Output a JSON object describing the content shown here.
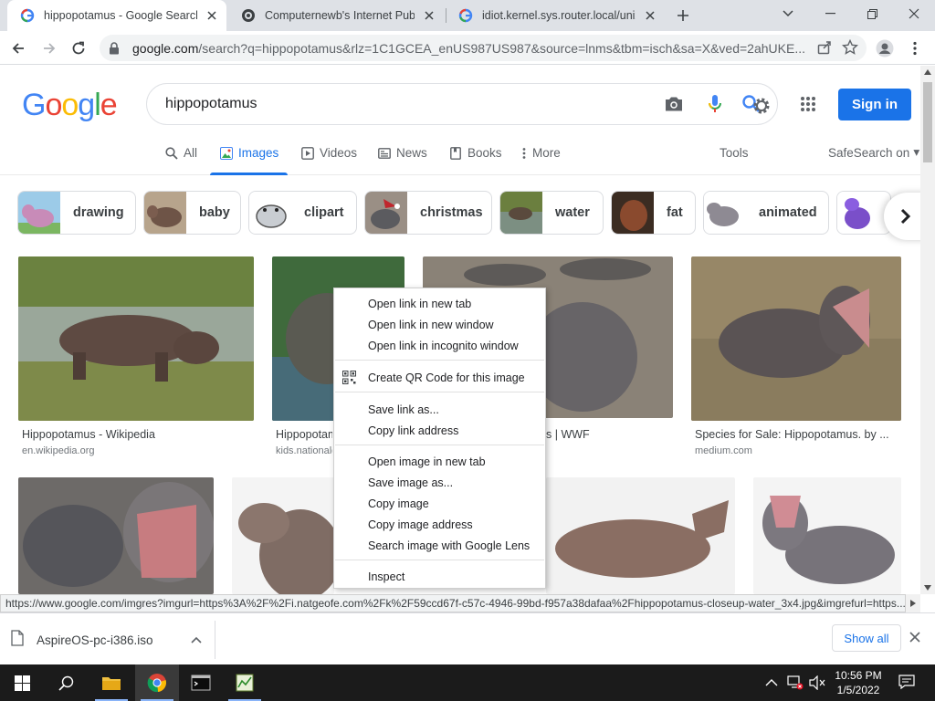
{
  "browser": {
    "tabs": [
      {
        "title": "hippopotamus - Google Search",
        "favicon": "google-icon",
        "active": true
      },
      {
        "title": "Computernewb's Internet Pub Hub",
        "favicon": "discord-like-icon",
        "active": false
      },
      {
        "title": "idiot.kernel.sys.router.local/unix/",
        "favicon": "google-icon",
        "active": false
      }
    ],
    "url": {
      "domain": "google.com",
      "path": "/search?q=hippopotamus&rlz=1C1GCEA_enUS987US987&source=lnms&tbm=isch&sa=X&ved=2ahUKE..."
    }
  },
  "google": {
    "logo": [
      "G",
      "o",
      "o",
      "g",
      "l",
      "e"
    ],
    "logo_colors": [
      "#4285f4",
      "#ea4335",
      "#fbbc05",
      "#4285f4",
      "#34a853",
      "#ea4335"
    ],
    "query": "hippopotamus",
    "signin_label": "Sign in",
    "tabs": [
      {
        "label": "All",
        "icon": "search-icon"
      },
      {
        "label": "Images",
        "icon": "image-icon",
        "selected": true
      },
      {
        "label": "Videos",
        "icon": "play-icon"
      },
      {
        "label": "News",
        "icon": "news-icon"
      },
      {
        "label": "Books",
        "icon": "book-icon"
      },
      {
        "label": "More",
        "icon": "more-vert-icon"
      }
    ],
    "tools_label": "Tools",
    "safesearch_label": "SafeSearch on",
    "chips": [
      "drawing",
      "baby",
      "clipart",
      "christmas",
      "water",
      "fat",
      "animated"
    ],
    "results": [
      {
        "title": "Hippopotamus - Wikipedia",
        "source": "en.wikipedia.org"
      },
      {
        "title": "Hippopotamus",
        "source": "kids.nationalgeographic.com"
      },
      {
        "title": "Hippopotamus | WWF",
        "source": ""
      },
      {
        "title": "Species for Sale: Hippopotamus. by ...",
        "source": "medium.com"
      }
    ]
  },
  "context_menu": {
    "items": [
      "Open link in new tab",
      "Open link in new window",
      "Open link in incognito window",
      "Create QR Code for this image",
      "Save link as...",
      "Copy link address",
      "Open image in new tab",
      "Save image as...",
      "Copy image",
      "Copy image address",
      "Search image with Google Lens",
      "Inspect"
    ]
  },
  "status_url": "https://www.google.com/imgres?imgurl=https%3A%2F%2Fi.natgeofe.com%2Fk%2F59ccd67f-c57c-4946-99bd-f957a38dafaa%2Fhippopotamus-closeup-water_3x4.jpg&imgrefurl=https...",
  "downloads": {
    "file_name": "AspireOS-pc-i386.iso",
    "show_all_label": "Show all"
  },
  "taskbar": {
    "time": "10:56 PM",
    "date": "1/5/2022"
  },
  "colors": {
    "accent": "#1a73e8",
    "tabstrip": "#dee1e6",
    "taskbar": "#1b1b1b"
  }
}
